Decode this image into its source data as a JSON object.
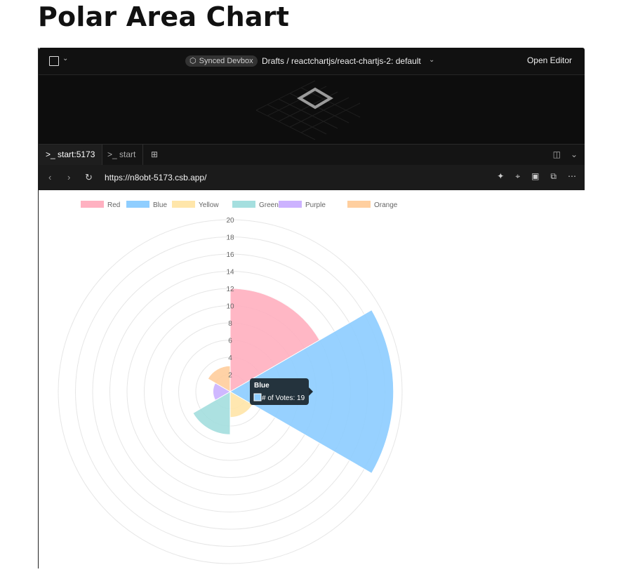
{
  "page": {
    "title": "Polar Area Chart"
  },
  "topbar": {
    "badge": "Synced Devbox",
    "breadcrumb": "Drafts / reactchartjs/react-chartjs-2: default",
    "open_editor": "Open Editor"
  },
  "tabs": [
    {
      "label": "start:5173"
    },
    {
      "label": "start"
    }
  ],
  "urlbar": {
    "url": "https://n8obt-5173.csb.app/"
  },
  "icons": {
    "menu": "square-menu-icon",
    "add_tab": "plus-square-icon",
    "split": "split-view-icon",
    "back": "chevron-left-icon",
    "forward": "chevron-right-icon",
    "reload": "reload-icon",
    "sparkle": "sparkle-icon",
    "target": "crosshair-icon",
    "terminal": "terminal-icon",
    "external": "open-window-icon",
    "more": "more-icon"
  },
  "chart_data": {
    "type": "polarArea",
    "categories": [
      "Red",
      "Blue",
      "Yellow",
      "Green",
      "Purple",
      "Orange"
    ],
    "series": [
      {
        "name": "# of Votes",
        "values": [
          12,
          19,
          3,
          5,
          2,
          3
        ]
      }
    ],
    "colors": [
      "#ffb1c1",
      "#8fceff",
      "#ffe6aa",
      "#a5dfdf",
      "#ccb2ff",
      "#ffcf9f"
    ],
    "r_ticks": [
      "2",
      "4",
      "6",
      "8",
      "10",
      "12",
      "14",
      "16",
      "18",
      "20"
    ],
    "r_range": [
      0,
      20
    ],
    "legend_position": "top",
    "tooltip": {
      "title": "Blue",
      "label": "# of Votes: 19"
    }
  }
}
